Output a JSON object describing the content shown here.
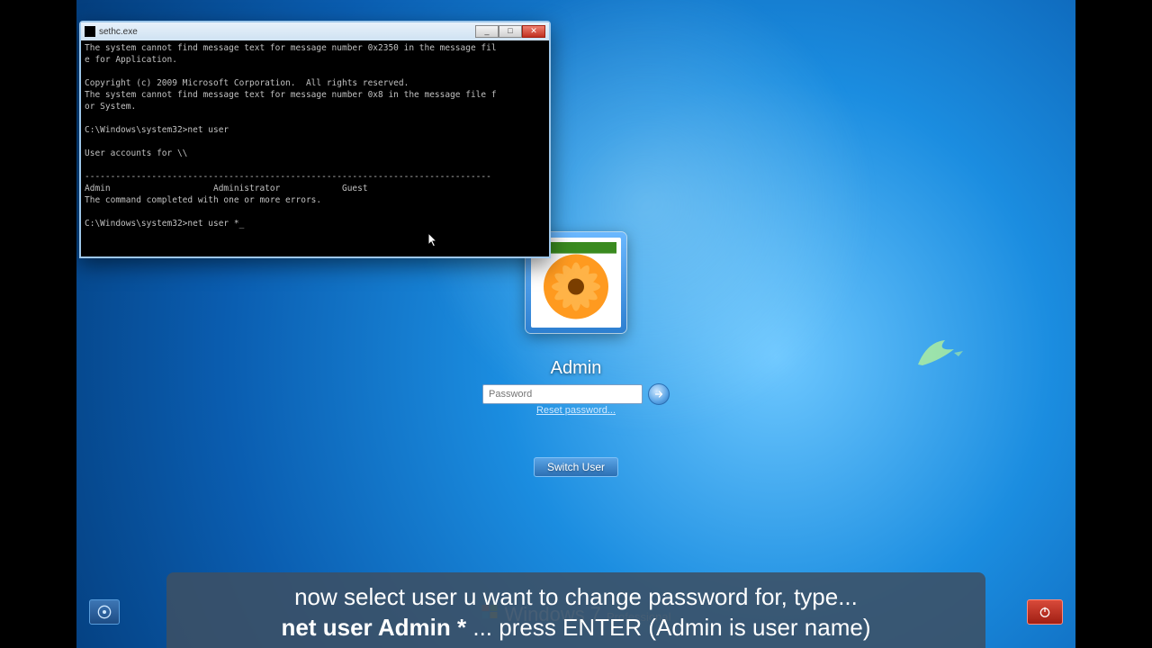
{
  "cmd": {
    "title": "sethc.exe",
    "lines_1": "The system cannot find message text for message number 0x2350 in the message fil\ne for Application.\n\nCopyright (c) 2009 Microsoft Corporation.  All rights reserved.\nThe system cannot find message text for message number 0x8 in the message file f\nor System.\n\nC:\\Windows\\system32>net user\n\nUser accounts for \\\\\n",
    "separator": "-------------------------------------------------------------------------------",
    "users_row": "Admin                    Administrator            Guest",
    "completed": "The command completed with one or more errors.",
    "prompt2": "C:\\Windows\\system32>net user *_"
  },
  "login": {
    "username": "Admin",
    "password_placeholder": "Password",
    "reset_link": "Reset password...",
    "switch_user": "Switch User"
  },
  "branding": {
    "l1": "Windows",
    "l2": "7",
    "l3": "Professional"
  },
  "caption": {
    "line1": "now select user u want to change password for, type...",
    "bold": "net user Admin *",
    "line2": " ... press ENTER (Admin is user name)"
  }
}
